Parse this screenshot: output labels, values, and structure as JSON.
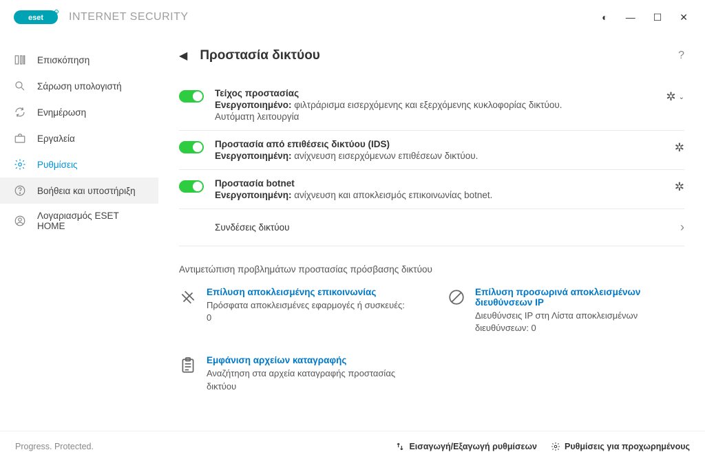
{
  "brand": {
    "name": "INTERNET SECURITY"
  },
  "sidebar": {
    "items": [
      {
        "label": "Επισκόπηση"
      },
      {
        "label": "Σάρωση υπολογιστή"
      },
      {
        "label": "Ενημέρωση"
      },
      {
        "label": "Εργαλεία"
      },
      {
        "label": "Ρυθμίσεις"
      },
      {
        "label": "Βοήθεια και υποστήριξη"
      },
      {
        "label": "Λογαριασμός ESET HOME"
      }
    ]
  },
  "page": {
    "title": "Προστασία δικτύου",
    "help": "?"
  },
  "protection": [
    {
      "title": "Τείχος προστασίας",
      "status_label": "Ενεργοποιημένο:",
      "status_desc": "φιλτράρισμα εισερχόμενης και εξερχόμενης κυκλοφορίας δικτύου.",
      "extra": "Αυτόματη λειτουργία",
      "has_dropdown": true
    },
    {
      "title": "Προστασία από επιθέσεις δικτύου (IDS)",
      "status_label": "Ενεργοποιημένη:",
      "status_desc": "ανίχνευση εισερχόμενων επιθέσεων δικτύου.",
      "extra": "",
      "has_dropdown": false
    },
    {
      "title": "Προστασία botnet",
      "status_label": "Ενεργοποιημένη:",
      "status_desc": "ανίχνευση και αποκλεισμός επικοινωνίας botnet.",
      "extra": "",
      "has_dropdown": false
    }
  ],
  "connections_link": "Συνδέσεις δικτύου",
  "trouble_section": "Αντιμετώπιση προβλημάτων προστασίας πρόσβασης δικτύου",
  "trouble": [
    {
      "title": "Επίλυση αποκλεισμένης επικοινωνίας",
      "desc": "Πρόσφατα αποκλεισμένες εφαρμογές ή συσκευές: 0"
    },
    {
      "title": "Επίλυση προσωρινά αποκλεισμένων διευθύνσεων IP",
      "desc": "Διευθύνσεις IP στη Λίστα αποκλεισμένων διευθύνσεων: 0"
    },
    {
      "title": "Εμφάνιση αρχείων καταγραφής",
      "desc": "Αναζήτηση στα αρχεία καταγραφής προστασίας δικτύου"
    }
  ],
  "footer": {
    "tagline": "Progress. Protected.",
    "import_export": "Εισαγωγή/Εξαγωγή ρυθμίσεων",
    "advanced": "Ρυθμίσεις για προχωρημένους"
  }
}
